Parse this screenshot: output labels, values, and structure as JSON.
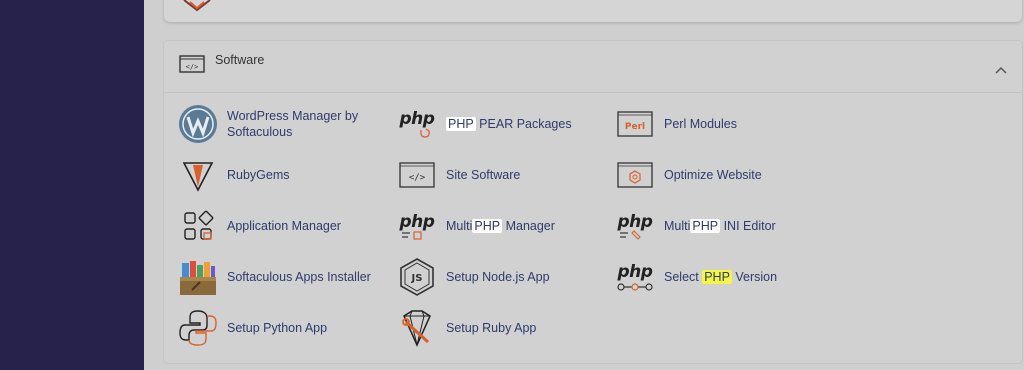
{
  "section": {
    "title": "Software",
    "items": [
      {
        "label": "WordPress Manager by Softaculous",
        "icon": "wordpress-icon"
      },
      {
        "label_pre": "",
        "label_hl": "PHP",
        "label_post": " PEAR Packages",
        "icon": "php-pear-icon"
      },
      {
        "label": "Perl Modules",
        "icon": "perl-icon"
      },
      {
        "label": "RubyGems",
        "icon": "rubygems-icon"
      },
      {
        "label": "Site Software",
        "icon": "site-software-icon"
      },
      {
        "label": "Optimize Website",
        "icon": "optimize-website-icon"
      },
      {
        "label": "Application Manager",
        "icon": "application-manager-icon"
      },
      {
        "label_pre": "Multi",
        "label_hl": "PHP",
        "label_post": " Manager",
        "icon": "multiphp-manager-icon"
      },
      {
        "label_pre": "Multi",
        "label_hl": "PHP",
        "label_post": " INI Editor",
        "icon": "multiphp-ini-editor-icon"
      },
      {
        "label": "Softaculous Apps Installer",
        "icon": "softaculous-icon"
      },
      {
        "label": "Setup Node.js App",
        "icon": "nodejs-icon"
      },
      {
        "label_pre": "Select ",
        "label_hl": "PHP",
        "label_post": " Version",
        "icon": "select-php-version-icon"
      },
      {
        "label": "Setup Python App",
        "icon": "python-icon"
      },
      {
        "label": "Setup Ruby App",
        "icon": "ruby-app-icon"
      }
    ]
  },
  "icons": {
    "php_text": "php",
    "perl_text": "Perl",
    "code_text": "</>"
  },
  "colors": {
    "sidebar": "#26224c",
    "link": "#2f3b6b",
    "accent_orange": "#d9622b",
    "highlight_yellow": "#f5f545"
  }
}
